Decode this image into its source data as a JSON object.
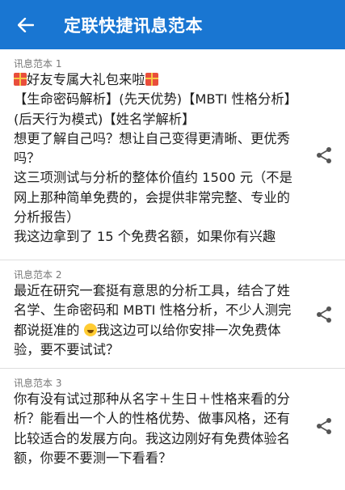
{
  "appbar": {
    "title": "定联快捷讯息范本",
    "back_icon": "arrow-left-icon",
    "background": "#1976d2"
  },
  "templates": [
    {
      "label": "讯息范本 1",
      "line1": "好友专属大礼包来啦",
      "rest": "【生命密码解析】(先天优势)【MBTI 性格分析】(后天行为模式)【姓名学解析】\n想更了解自己吗？想让自己变得更清晰、更优秀吗？\n这三项测试与分析的整体价值约 1500 元（不是网上那种简单免费的，会提供非常完整、专业的分析报告）\n我这边拿到了 15 个免费名额，如果你有兴趣",
      "share_icon": "share-icon"
    },
    {
      "label": "讯息范本 2",
      "part1": "最近在研究一套挺有意思的分析工具，结合了姓名学、生命密码和 MBTI 性格分析，不少人测完都说挺准的 ",
      "part2": "我这边可以给你安排一次免费体验，要不要试试？",
      "share_icon": "share-icon"
    },
    {
      "label": "讯息范本 3",
      "text": "你有没有试过那种从名字＋生日＋性格来看的分析？能看出一个人的性格优势、做事风格，还有比较适合的发展方向。我这边刚好有免费体验名额，你要不要测一下看看？",
      "share_icon": "share-icon"
    }
  ]
}
